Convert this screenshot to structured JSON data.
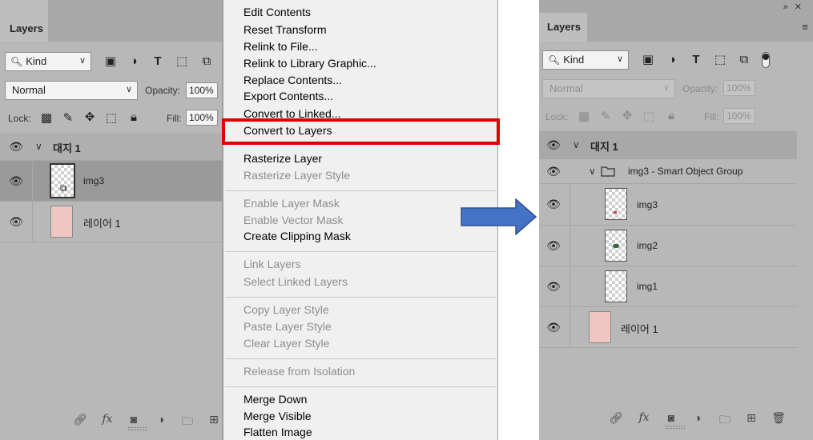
{
  "left_panel": {
    "tab_title": "Layers",
    "filter_kind": "Kind",
    "blend_mode": "Normal",
    "opacity_label": "Opacity:",
    "opacity_value": "100%",
    "lock_label": "Lock:",
    "fill_label": "Fill:",
    "fill_value": "100%",
    "group_name": "대지 1",
    "layers": [
      {
        "name": "img3"
      },
      {
        "name": "레이어 1"
      }
    ]
  },
  "context_menu": {
    "items": [
      {
        "label": "Edit Contents",
        "enabled": true
      },
      {
        "label": "Reset Transform",
        "enabled": true
      },
      {
        "label": "Relink to File...",
        "enabled": true
      },
      {
        "label": "Relink to Library Graphic...",
        "enabled": true
      },
      {
        "label": "Replace Contents...",
        "enabled": true
      },
      {
        "label": "Export Contents...",
        "enabled": true
      },
      {
        "label": "Convert to Linked...",
        "enabled": true
      },
      {
        "label": "Convert to Layers",
        "enabled": true
      },
      {
        "label": "Rasterize Layer",
        "enabled": true
      },
      {
        "label": "Rasterize Layer Style",
        "enabled": false
      },
      {
        "label": "Enable Layer Mask",
        "enabled": false
      },
      {
        "label": "Enable Vector Mask",
        "enabled": false
      },
      {
        "label": "Create Clipping Mask",
        "enabled": true
      },
      {
        "label": "Link Layers",
        "enabled": false
      },
      {
        "label": "Select Linked Layers",
        "enabled": false
      },
      {
        "label": "Copy Layer Style",
        "enabled": false
      },
      {
        "label": "Paste Layer Style",
        "enabled": false
      },
      {
        "label": "Clear Layer Style",
        "enabled": false
      },
      {
        "label": "Release from Isolation",
        "enabled": false
      },
      {
        "label": "Merge Down",
        "enabled": true
      },
      {
        "label": "Merge Visible",
        "enabled": true
      },
      {
        "label": "Flatten Image",
        "enabled": true
      }
    ],
    "highlighted_item": "Convert to Layers",
    "highlight_color": "#e00000"
  },
  "arrow_color": "#4472c4",
  "right_panel": {
    "tab_title": "Layers",
    "filter_kind": "Kind",
    "blend_mode": "Normal",
    "opacity_label": "Opacity:",
    "opacity_value": "100%",
    "lock_label": "Lock:",
    "fill_label": "Fill:",
    "fill_value": "100%",
    "artboard_name": "대지 1",
    "group_name": "img3 - Smart Object Group",
    "layers": [
      {
        "name": "img3"
      },
      {
        "name": "img2"
      },
      {
        "name": "img1"
      },
      {
        "name": "레이어 1"
      }
    ]
  }
}
